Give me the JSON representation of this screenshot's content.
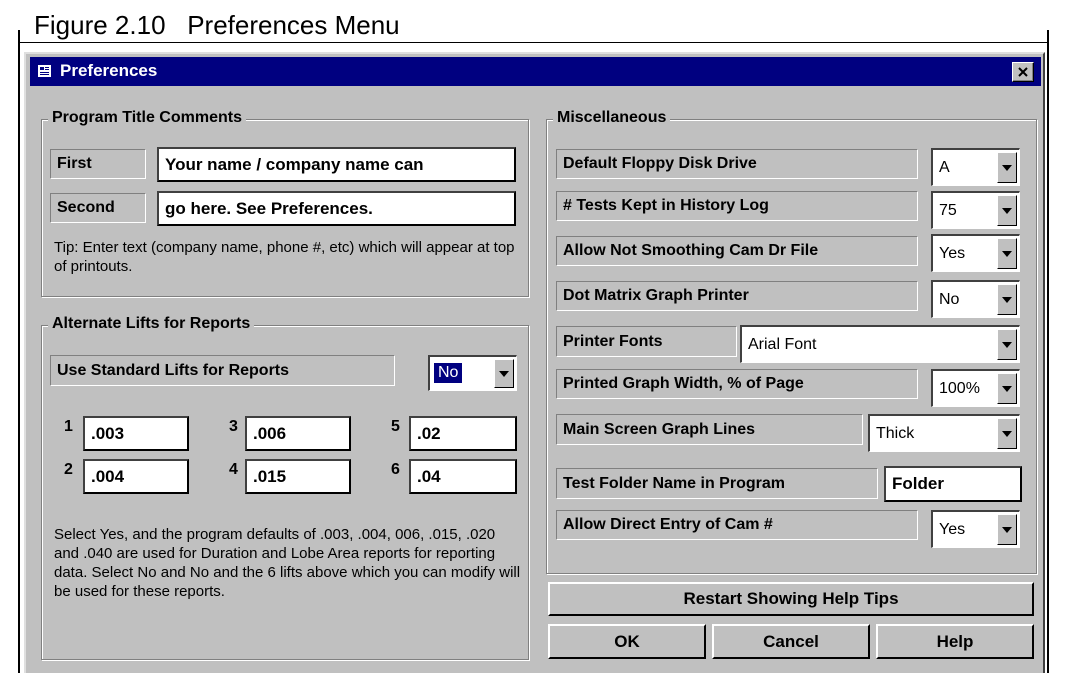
{
  "figure_caption": "Figure 2.10   Preferences Menu",
  "window": {
    "title": "Preferences",
    "close_glyph": "×"
  },
  "program_title": {
    "header": "Program Title Comments",
    "first_label": "First",
    "first_value": "Your name / company name can",
    "second_label": "Second",
    "second_value": "go here.  See Preferences.",
    "tip": "Tip:  Enter text (company name, phone #, etc) which will appear at top of printouts."
  },
  "alternate_lifts": {
    "header": "Alternate Lifts for Reports",
    "use_standard_label": "Use Standard Lifts for Reports",
    "use_standard_value": "No",
    "lifts": [
      {
        "num": "1",
        "value": ".003"
      },
      {
        "num": "2",
        "value": ".004"
      },
      {
        "num": "3",
        "value": ".006"
      },
      {
        "num": "4",
        "value": ".015"
      },
      {
        "num": "5",
        "value": ".02"
      },
      {
        "num": "6",
        "value": ".04"
      }
    ],
    "note": "Select Yes, and the program defaults of .003, .004, 006, .015, .020 and .040 are used for Duration and Lobe Area reports for reporting data.  Select No and No and the 6 lifts above which you can modify will be used for these reports."
  },
  "misc": {
    "header": "Miscellaneous",
    "floppy_label": "Default Floppy Disk Drive",
    "floppy_value": "A",
    "tests_label": "# Tests Kept in History Log",
    "tests_value": "75",
    "smoothing_label": "Allow Not Smoothing Cam Dr File",
    "smoothing_value": "Yes",
    "dotmatrix_label": "Dot Matrix Graph Printer",
    "dotmatrix_value": "No",
    "fonts_label": "Printer Fonts",
    "fonts_value": "Arial Font",
    "graph_width_label": "Printed Graph Width, % of Page",
    "graph_width_value": "100%",
    "graph_lines_label": "Main Screen Graph Lines",
    "graph_lines_value": "Thick",
    "folder_label": "Test Folder Name in Program",
    "folder_value": "Folder",
    "direct_entry_label": "Allow Direct Entry of Cam #",
    "direct_entry_value": "Yes"
  },
  "buttons": {
    "restart_tips": "Restart Showing Help Tips",
    "ok": "OK",
    "cancel": "Cancel",
    "help": "Help"
  }
}
